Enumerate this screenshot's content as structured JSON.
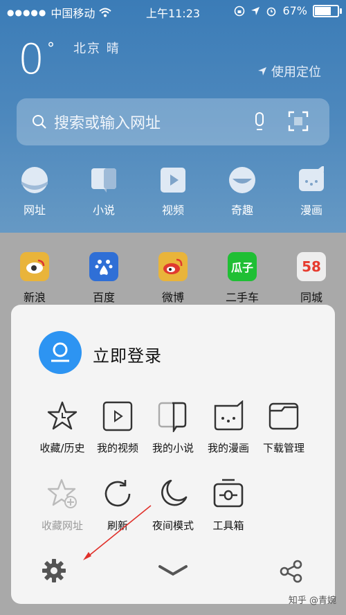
{
  "status": {
    "carrier": "中国移动",
    "time": "上午11:23",
    "battery": "67%",
    "battery_level": 0.67
  },
  "weather": {
    "temp": "0",
    "city": "北京  晴",
    "locate": "使用定位"
  },
  "search": {
    "placeholder": "搜索或输入网址"
  },
  "nav": [
    {
      "icon": "globe-icon",
      "label": "网址"
    },
    {
      "icon": "book-icon",
      "label": "小说"
    },
    {
      "icon": "video-icon",
      "label": "视频"
    },
    {
      "icon": "fun-icon",
      "label": "奇趣"
    },
    {
      "icon": "comic-icon",
      "label": "漫画"
    }
  ],
  "apps": [
    {
      "icon": "sina-icon",
      "label": "新浪",
      "color": "#f4b93a"
    },
    {
      "icon": "baidu-icon",
      "label": "百度",
      "color": "#2f6fd6"
    },
    {
      "icon": "weibo-icon",
      "label": "微博",
      "color": "#f4b93a"
    },
    {
      "icon": "guazi-icon",
      "label": "二手车",
      "color": "#1fbf34",
      "text": "瓜子"
    },
    {
      "icon": "58-icon",
      "label": "同城",
      "color": "#f2f2f2",
      "text": "58"
    }
  ],
  "panel": {
    "login": "立即登录",
    "menu_row1": [
      {
        "icon": "star-clock-icon",
        "label": "收藏/历史"
      },
      {
        "icon": "my-video-icon",
        "label": "我的视频"
      },
      {
        "icon": "my-novel-icon",
        "label": "我的小说"
      },
      {
        "icon": "my-comic-icon",
        "label": "我的漫画"
      },
      {
        "icon": "folder-icon",
        "label": "下载管理"
      }
    ],
    "menu_row2": [
      {
        "icon": "star-add-icon",
        "label": "收藏网址"
      },
      {
        "icon": "refresh-icon",
        "label": "刷新"
      },
      {
        "icon": "moon-icon",
        "label": "夜间模式"
      },
      {
        "icon": "toolbox-icon",
        "label": "工具箱"
      }
    ]
  },
  "watermark": "知乎 @青婉",
  "colors": {
    "accent": "#2d94f2",
    "header": "#3b7cb7",
    "arrow": "#e0302a"
  }
}
